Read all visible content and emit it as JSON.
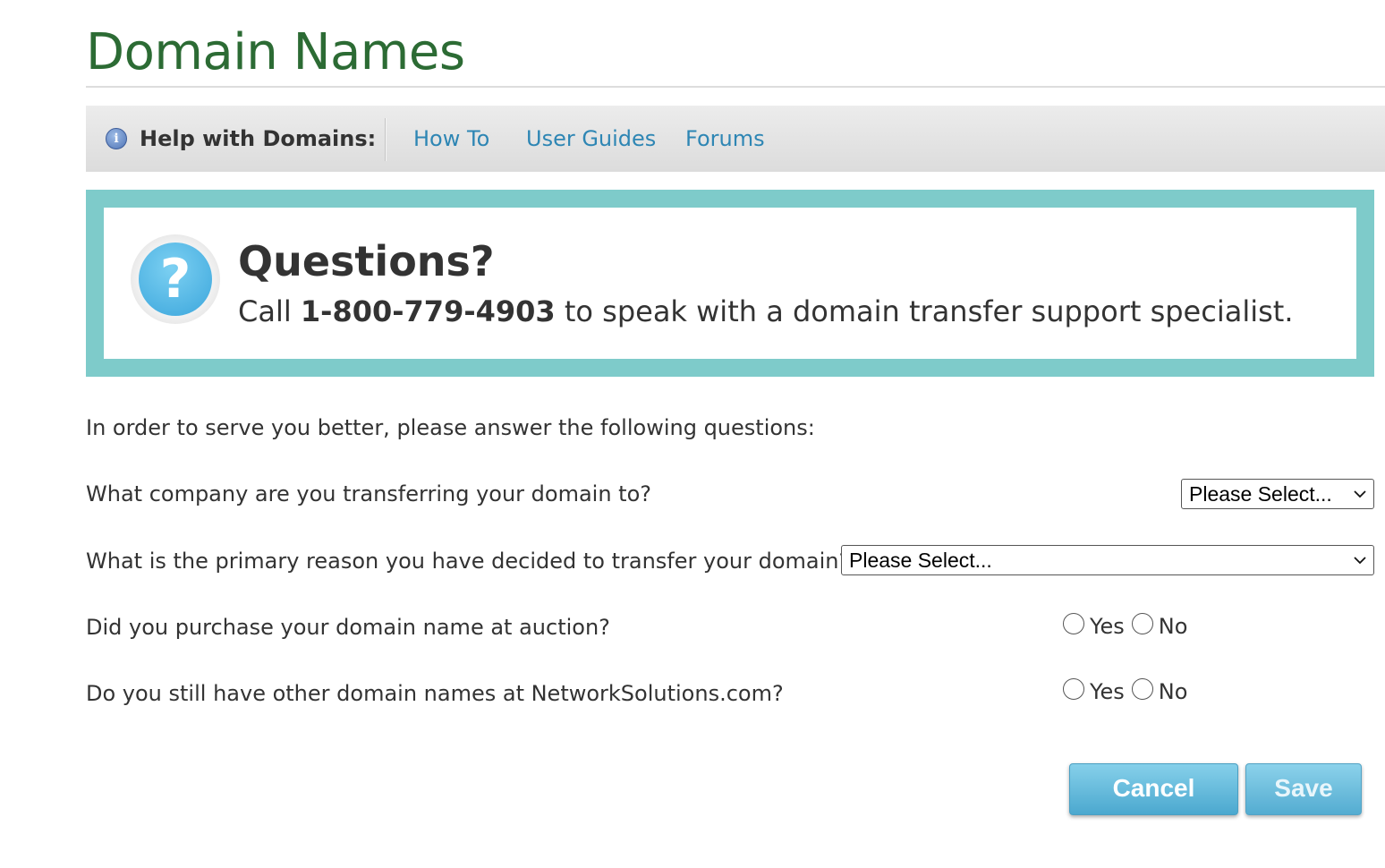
{
  "page": {
    "title": "Domain Names"
  },
  "help_bar": {
    "icon": "info-icon",
    "icon_glyph": "i",
    "label": "Help with Domains:",
    "links": [
      "How To",
      "User Guides",
      "Forums"
    ]
  },
  "questions_box": {
    "icon": "question-mark-icon",
    "icon_glyph": "?",
    "title": "Questions?",
    "text_before": "Call ",
    "phone": "1-800-779-4903",
    "text_after": " to speak with a domain transfer support specialist.",
    "border_color": "#7ecbca"
  },
  "form": {
    "intro": "In order to serve you better, please answer the following questions:",
    "q1": {
      "label": "What company are you transferring your domain to?",
      "select_value": "Please Select..."
    },
    "q2": {
      "label": "What is the primary reason you have decided to transfer your domain?",
      "select_value": "Please Select..."
    },
    "q3": {
      "label": "Did you purchase your domain name at auction?",
      "yes": "Yes",
      "no": "No"
    },
    "q4": {
      "label": "Do you still have other domain names at NetworkSolutions.com?",
      "yes": "Yes",
      "no": "No"
    }
  },
  "buttons": {
    "cancel": "Cancel",
    "save": "Save"
  },
  "colors": {
    "title": "#2c6b34",
    "link": "#2e86b4",
    "button": "#4ba8cf"
  }
}
